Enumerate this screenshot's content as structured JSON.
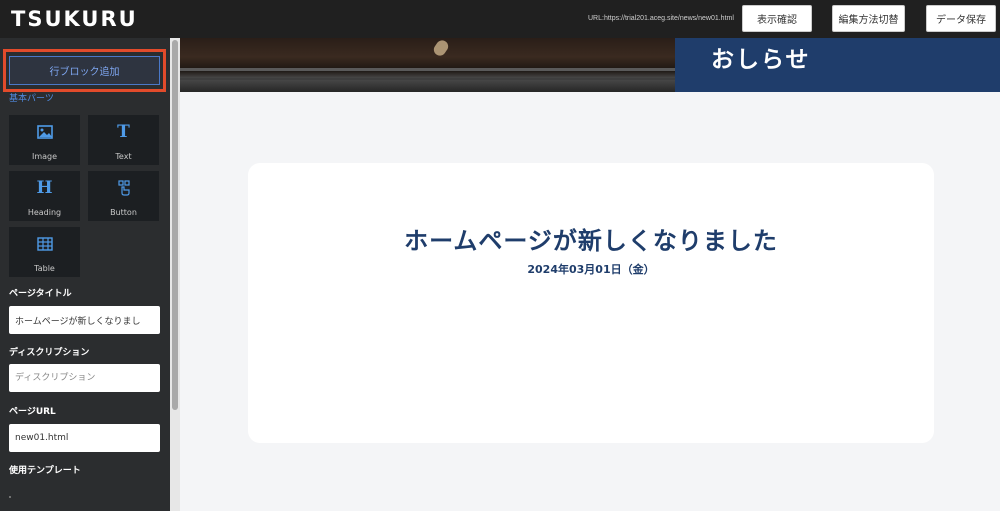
{
  "app": {
    "logo": "TSUKURU"
  },
  "header": {
    "url_text": "URL:https://trial201.aceg.site/news/new01.html",
    "buttons": {
      "preview": "表示確認",
      "switch_mode": "編集方法切替",
      "save": "データ保存"
    }
  },
  "sidebar": {
    "add_row_button": "行ブロック追加",
    "basic_parts_label": "基本パーツ",
    "parts": [
      {
        "label": "Image",
        "icon": "image-icon"
      },
      {
        "label": "Text",
        "icon": "text-icon"
      },
      {
        "label": "Heading",
        "icon": "heading-icon"
      },
      {
        "label": "Button",
        "icon": "button-icon"
      },
      {
        "label": "Table",
        "icon": "table-icon"
      }
    ],
    "page_title_label": "ページタイトル",
    "page_title_value": "ホームページが新しくなりまし",
    "description_label": "ディスクリプション",
    "description_placeholder": "ディスクリプション",
    "page_url_label": "ページURL",
    "page_url_value": "new01.html",
    "template_label": "使用テンプレート"
  },
  "main": {
    "hero_title": "おしらせ",
    "news_title": "ホームページが新しくなりました",
    "news_date": "2024年03月01日（金）"
  },
  "colors": {
    "topbar": "#202020",
    "sidebar": "#2b2d2f",
    "accent_blue": "#1f3d6b",
    "highlight_red": "#e24b2b",
    "link_blue": "#4f8be0"
  }
}
